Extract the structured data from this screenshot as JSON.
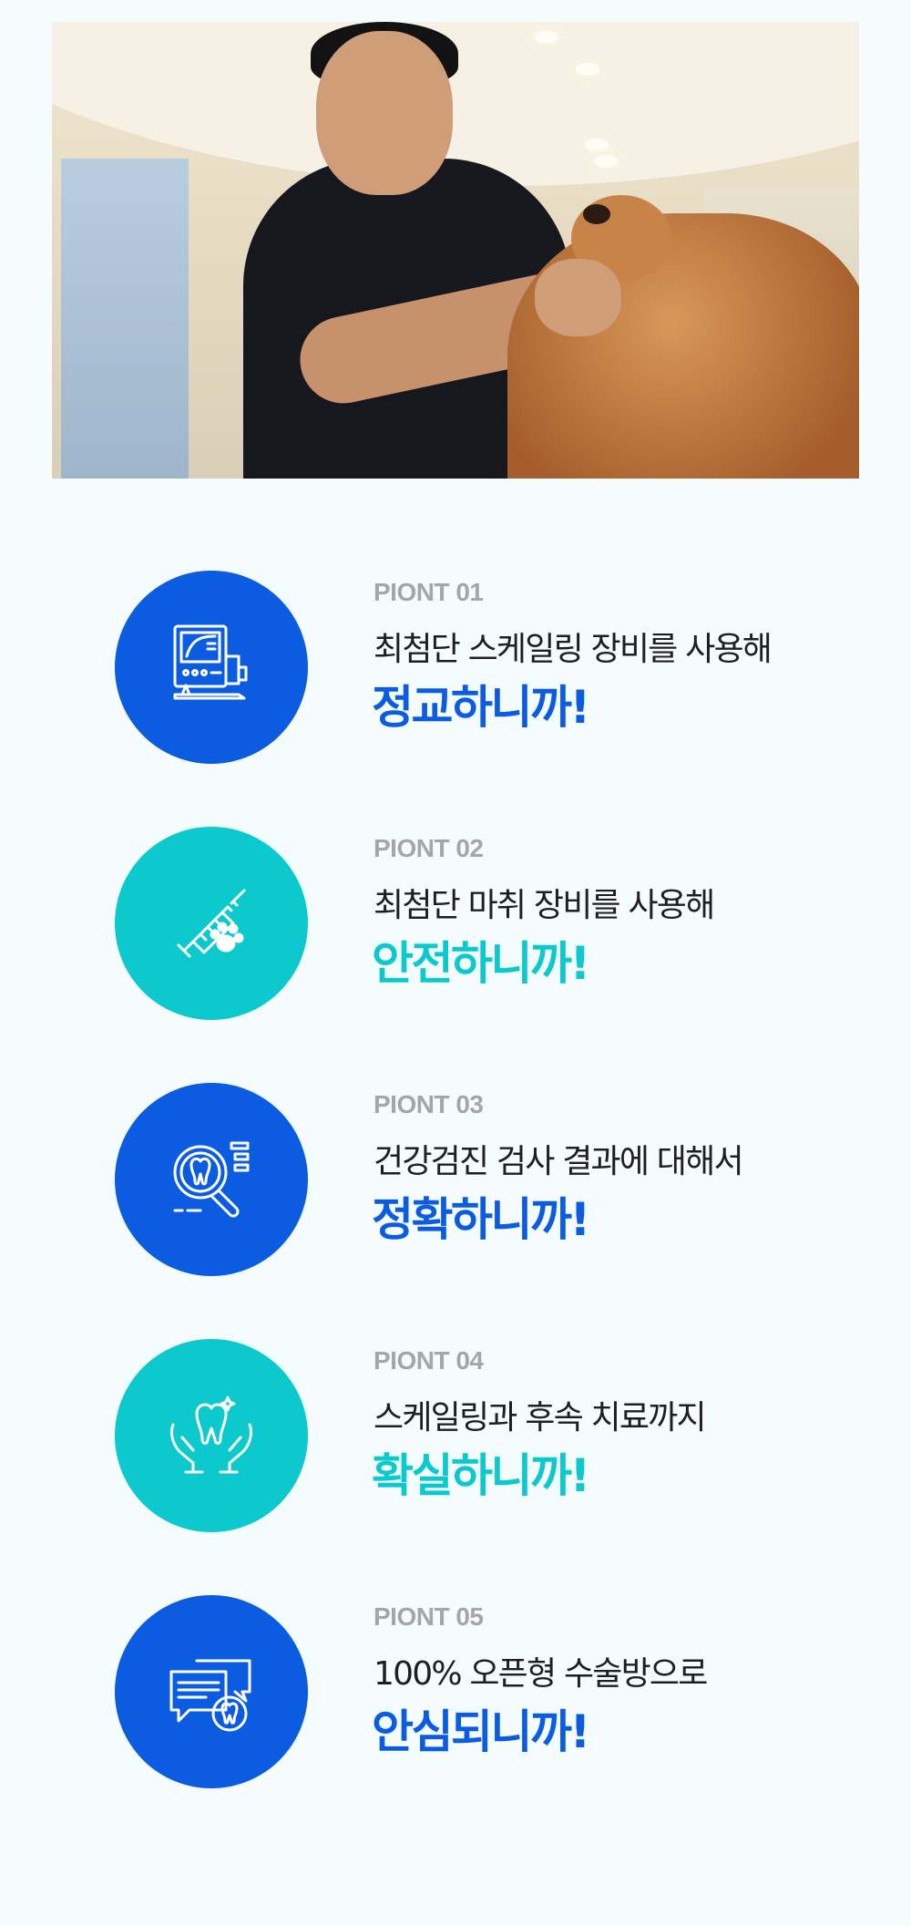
{
  "hero": {
    "alt_icon": "vet-with-dog-photo"
  },
  "colors": {
    "blue": "#0b5ce0",
    "teal": "#0cc9cd",
    "label_gray": "#a6a6a6",
    "text": "#1f1f1f",
    "background": "#f5fcfd"
  },
  "points": [
    {
      "label": "PIONT 01",
      "desc": "최첨단 스케일링 장비를 사용해",
      "highlight": "정교하니까!",
      "icon": "scaling-machine-icon",
      "color": "blue"
    },
    {
      "label": "PIONT 02",
      "desc": "최첨단 마취 장비를 사용해",
      "highlight": "안전하니까!",
      "icon": "syringe-paw-icon",
      "color": "teal"
    },
    {
      "label": "PIONT 03",
      "desc": "건강검진 검사 결과에 대해서",
      "highlight": "정확하니까!",
      "icon": "tooth-magnifier-icon",
      "color": "blue"
    },
    {
      "label": "PIONT 04",
      "desc": "스케일링과 후속 치료까지",
      "highlight": "확실하니까!",
      "icon": "hands-tooth-icon",
      "color": "teal"
    },
    {
      "label": "PIONT 05",
      "desc": "100% 오픈형 수술방으로",
      "highlight": "안심되니까!",
      "icon": "chat-tooth-icon",
      "color": "blue"
    }
  ]
}
